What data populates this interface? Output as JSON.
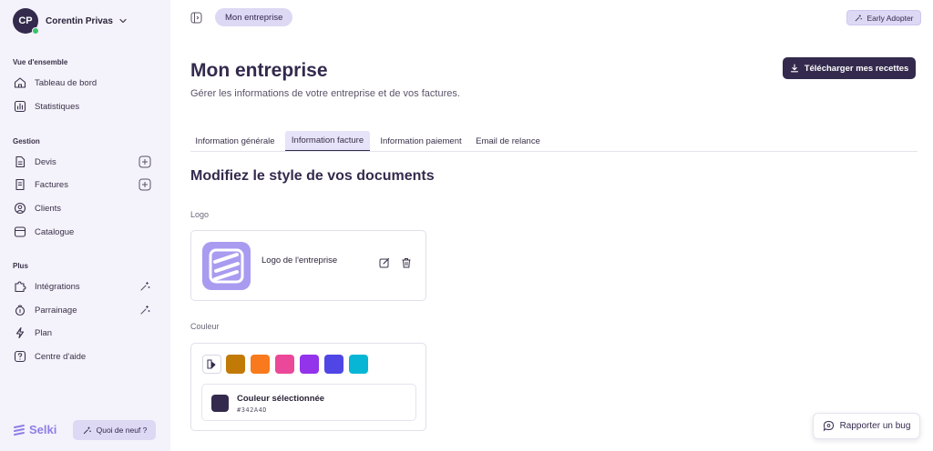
{
  "user": {
    "initials": "CP",
    "name": "Corentin Privas"
  },
  "sidebar": {
    "sections": {
      "overview": "Vue d'ensemble",
      "gestion": "Gestion",
      "plus": "Plus"
    },
    "items": [
      {
        "label": "Tableau de bord",
        "icon": "home-icon"
      },
      {
        "label": "Statistiques",
        "icon": "chart-icon"
      },
      {
        "label": "Devis",
        "icon": "document-icon",
        "action": "plus-icon"
      },
      {
        "label": "Factures",
        "icon": "invoice-icon",
        "action": "plus-icon"
      },
      {
        "label": "Clients",
        "icon": "user-circle-icon"
      },
      {
        "label": "Catalogue",
        "icon": "catalog-icon"
      },
      {
        "label": "Intégrations",
        "icon": "puzzle-icon",
        "action": "sparkle-icon"
      },
      {
        "label": "Parrainage",
        "icon": "gift-icon",
        "action": "sparkle-icon"
      },
      {
        "label": "Plan",
        "icon": "lightning-icon"
      },
      {
        "label": "Centre d'aide",
        "icon": "help-icon"
      }
    ],
    "brand": "Selki",
    "whats_new": "Quoi de neuf ?"
  },
  "header": {
    "breadcrumb": "Mon entreprise",
    "badge": "Early Adopter"
  },
  "main": {
    "title": "Mon entreprise",
    "subtitle": "Gérer les informations de votre entreprise et de vos factures.",
    "download_label": "Télécharger mes recettes",
    "tabs": [
      {
        "label": "Information générale"
      },
      {
        "label": "Information facture"
      },
      {
        "label": "Information paiement"
      },
      {
        "label": "Email de relance"
      }
    ],
    "active_tab": 1,
    "section_title": "Modifiez le style de vos documents",
    "logo": {
      "label": "Logo",
      "name": "Logo de l'entreprise"
    },
    "color": {
      "label": "Couleur",
      "swatches": [
        "#C27A06",
        "#F97A1C",
        "#EC4899",
        "#9333EA",
        "#4F46E5",
        "#06B6D4"
      ],
      "selected_label": "Couleur sélectionnée",
      "selected_hex": "#342A4D"
    }
  },
  "bug_report": "Rapporter un bug",
  "colors": {
    "primary": "#342A4D",
    "accent": "#A99BF0",
    "sidebar_bg": "#F4F2FB",
    "pill_bg": "#DDD8F4"
  }
}
